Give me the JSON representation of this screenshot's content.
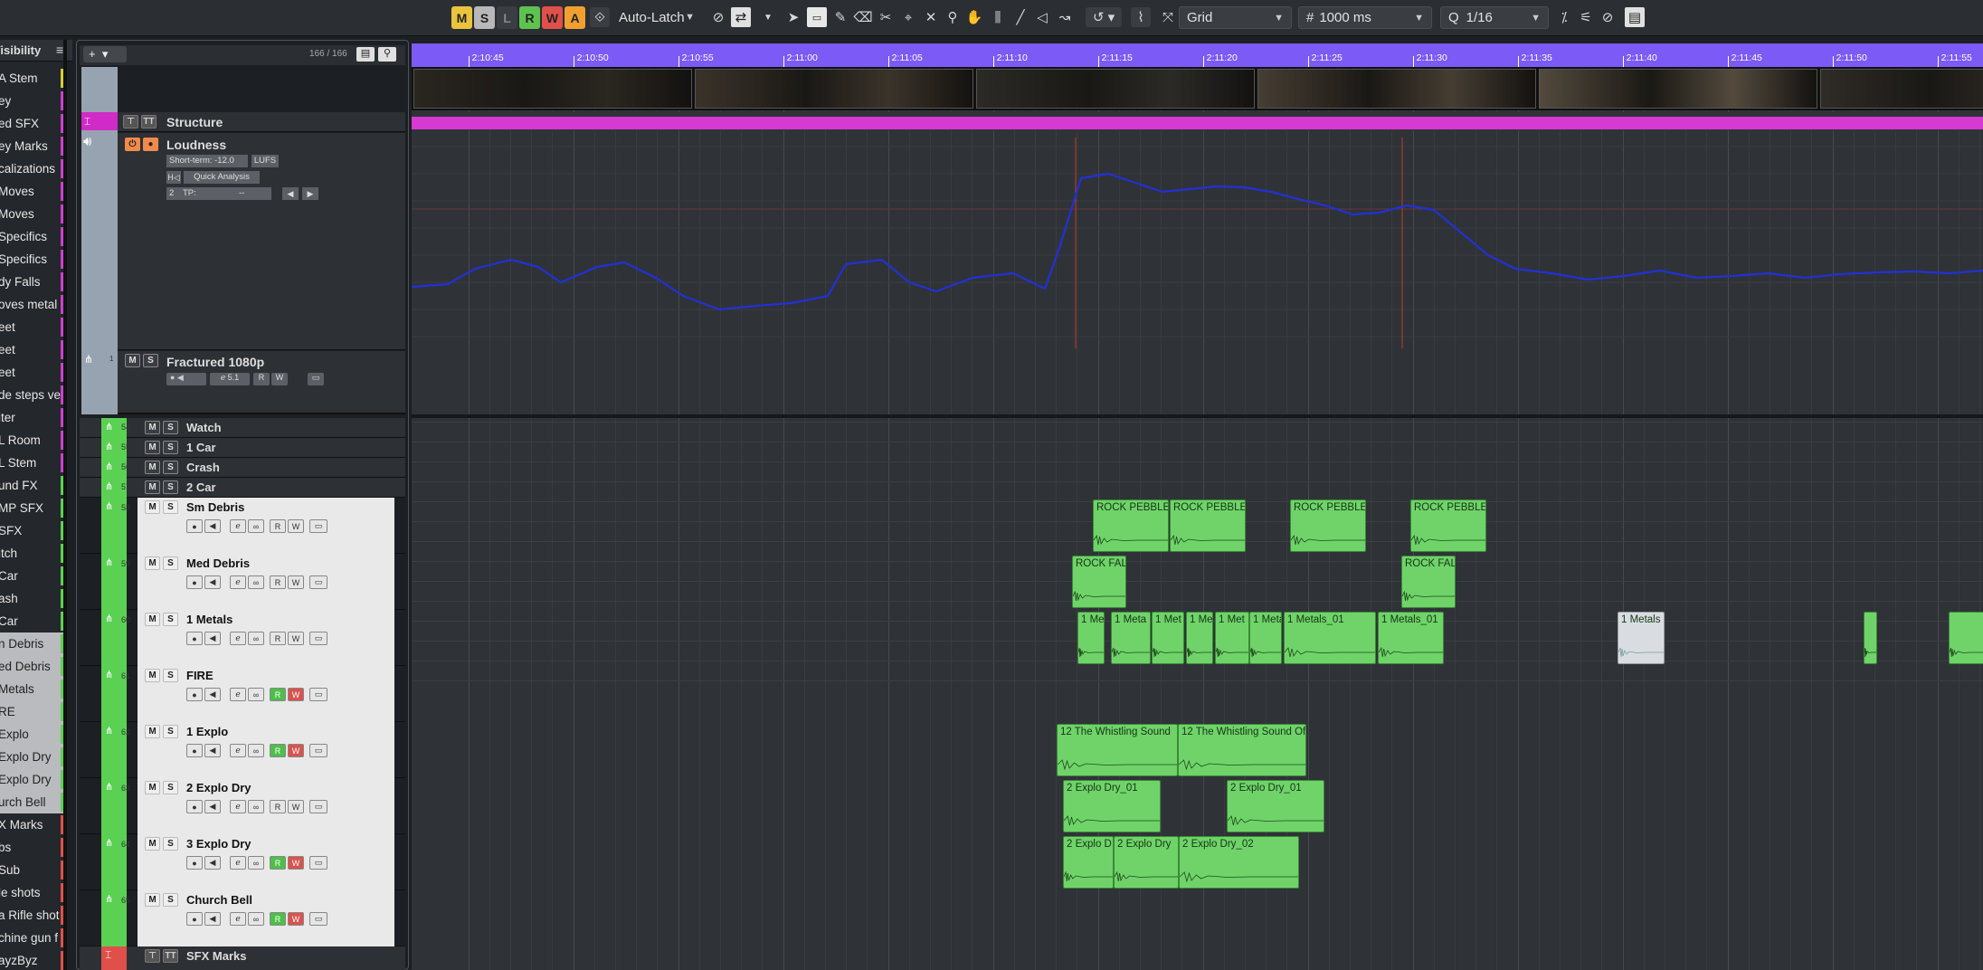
{
  "toolbar": {
    "mode_buttons": [
      {
        "label": "M",
        "color": "#e9c43c"
      },
      {
        "label": "S",
        "color": "#b8b8b8"
      },
      {
        "label": "L",
        "color": "#9a9a9a"
      },
      {
        "label": "R",
        "color": "#5ec24f"
      },
      {
        "label": "W",
        "color": "#e0504a"
      },
      {
        "label": "A",
        "color": "#f0a030"
      }
    ],
    "automation_mode": "Auto-Latch",
    "snap_type": "Grid",
    "grid_spacing": "1000 ms",
    "quantize": "1/16"
  },
  "visibility": {
    "title": "Visibility",
    "items": [
      {
        "label": "A Stem",
        "color": "#d8cc3a"
      },
      {
        "label": "ey",
        "color": "#cc3fd0"
      },
      {
        "label": "ed SFX",
        "color": "#cc3fd0"
      },
      {
        "label": "ey Marks",
        "color": "#cc3fd0"
      },
      {
        "label": "calizations",
        "color": "#cc3fd0"
      },
      {
        "label": "Moves",
        "color": "#cc3fd0"
      },
      {
        "label": "Moves",
        "color": "#cc3fd0"
      },
      {
        "label": "Specifics",
        "color": "#cc3fd0"
      },
      {
        "label": "Specifics",
        "color": "#cc3fd0"
      },
      {
        "label": "dy Falls",
        "color": "#cc3fd0"
      },
      {
        "label": "oves metal",
        "color": "#cc3fd0"
      },
      {
        "label": "eet",
        "color": "#cc3fd0"
      },
      {
        "label": "eet",
        "color": "#cc3fd0"
      },
      {
        "label": "eet",
        "color": "#cc3fd0"
      },
      {
        "label": "de steps ve",
        "color": "#cc3fd0"
      },
      {
        "label": "iter",
        "color": "#cc3fd0"
      },
      {
        "label": "L Room",
        "color": "#cc3fd0"
      },
      {
        "label": "L Stem",
        "color": "#cc3fd0"
      },
      {
        "label": "und FX",
        "color": "#5ad152"
      },
      {
        "label": "MP SFX",
        "color": "#5ad152"
      },
      {
        "label": "SFX",
        "color": "#5ad152"
      },
      {
        "label": "itch",
        "color": "#5ad152"
      },
      {
        "label": "Car",
        "color": "#5ad152"
      },
      {
        "label": "ash",
        "color": "#5ad152"
      },
      {
        "label": "Car",
        "color": "#5ad152"
      },
      {
        "label": "n Debris",
        "color": "#5ad152"
      },
      {
        "label": "ed Debris",
        "color": "#5ad152"
      },
      {
        "label": "Metals",
        "color": "#5ad152"
      },
      {
        "label": "RE",
        "color": "#5ad152"
      },
      {
        "label": "Explo",
        "color": "#5ad152"
      },
      {
        "label": "Explo Dry",
        "color": "#5ad152"
      },
      {
        "label": "Explo Dry",
        "color": "#5ad152"
      },
      {
        "label": "urch Bell",
        "color": "#5ad152"
      },
      {
        "label": "X Marks",
        "color": "#e0504a"
      },
      {
        "label": "bs",
        "color": "#e0504a"
      },
      {
        "label": "Sub",
        "color": "#e0504a"
      },
      {
        "label": "le shots",
        "color": "#e0504a"
      },
      {
        "label": "a Rifle shot",
        "color": "#e0504a"
      },
      {
        "label": "chine gun f",
        "color": "#e0504a"
      },
      {
        "label": "ayzByz",
        "color": "#e0504a"
      }
    ]
  },
  "tracklist": {
    "count": "166 / 166",
    "structure": {
      "name": "Structure"
    },
    "loudness": {
      "name": "Loudness",
      "short_term": "Short-term: -12.0",
      "unit": "LUFS",
      "analysis": "Quick Analysis",
      "tp_label": "TP:",
      "tp_value": "--",
      "tp_index": "2"
    },
    "video": {
      "name": "Fractured 1080p",
      "number": "1",
      "channel": "5.1"
    },
    "collapsed": [
      {
        "number": "54",
        "name": "Watch"
      },
      {
        "number": "55",
        "name": "1 Car"
      },
      {
        "number": "56",
        "name": "Crash"
      },
      {
        "number": "57",
        "name": "2 Car"
      }
    ],
    "tracks": [
      {
        "number": "58",
        "name": "Sm Debris",
        "armed": false
      },
      {
        "number": "59",
        "name": "Med Debris",
        "armed": false
      },
      {
        "number": "60",
        "name": "1 Metals",
        "armed": false
      },
      {
        "number": "61",
        "name": "FIRE",
        "armed": true
      },
      {
        "number": "62",
        "name": "1 Explo",
        "armed": true
      },
      {
        "number": "63",
        "name": "2 Explo Dry",
        "armed": false
      },
      {
        "number": "64",
        "name": "3 Explo Dry",
        "armed": true
      },
      {
        "number": "65",
        "name": "Church Bell",
        "armed": true
      }
    ],
    "folder": {
      "name": "SFX Marks"
    }
  },
  "ruler": {
    "ticks": [
      "2:10:45",
      "2:10:50",
      "2:10:55",
      "2:11:00",
      "2:11:05",
      "2:11:10",
      "2:11:15",
      "2:11:20",
      "2:11:25",
      "2:11:30",
      "2:11:35",
      "2:11:40",
      "2:11:45",
      "2:11:50",
      "2:11:55"
    ]
  },
  "clips": {
    "sm_debris": [
      "ROCK PEBBLE",
      "ROCK PEBBLE",
      "ROCK PEBBLE",
      "ROCK PEBBLE"
    ],
    "med_debris": [
      "ROCK FAL",
      "ROCK FAL"
    ],
    "metals": [
      "1 Me",
      "1 Meta",
      "1 Met",
      "1 Me",
      "1 Met",
      "1 Meta",
      "1 Metals_01",
      "1 Metals_01",
      "1 Metals",
      ""
    ],
    "explo1": [
      "12 The Whistling Sound",
      "12 The Whistling Sound Of"
    ],
    "explo2": [
      "2 Explo Dry_01",
      "2 Explo Dry_01"
    ],
    "explo3": [
      "2 Explo D",
      "2 Explo Dry",
      "2 Explo Dry_02"
    ]
  }
}
